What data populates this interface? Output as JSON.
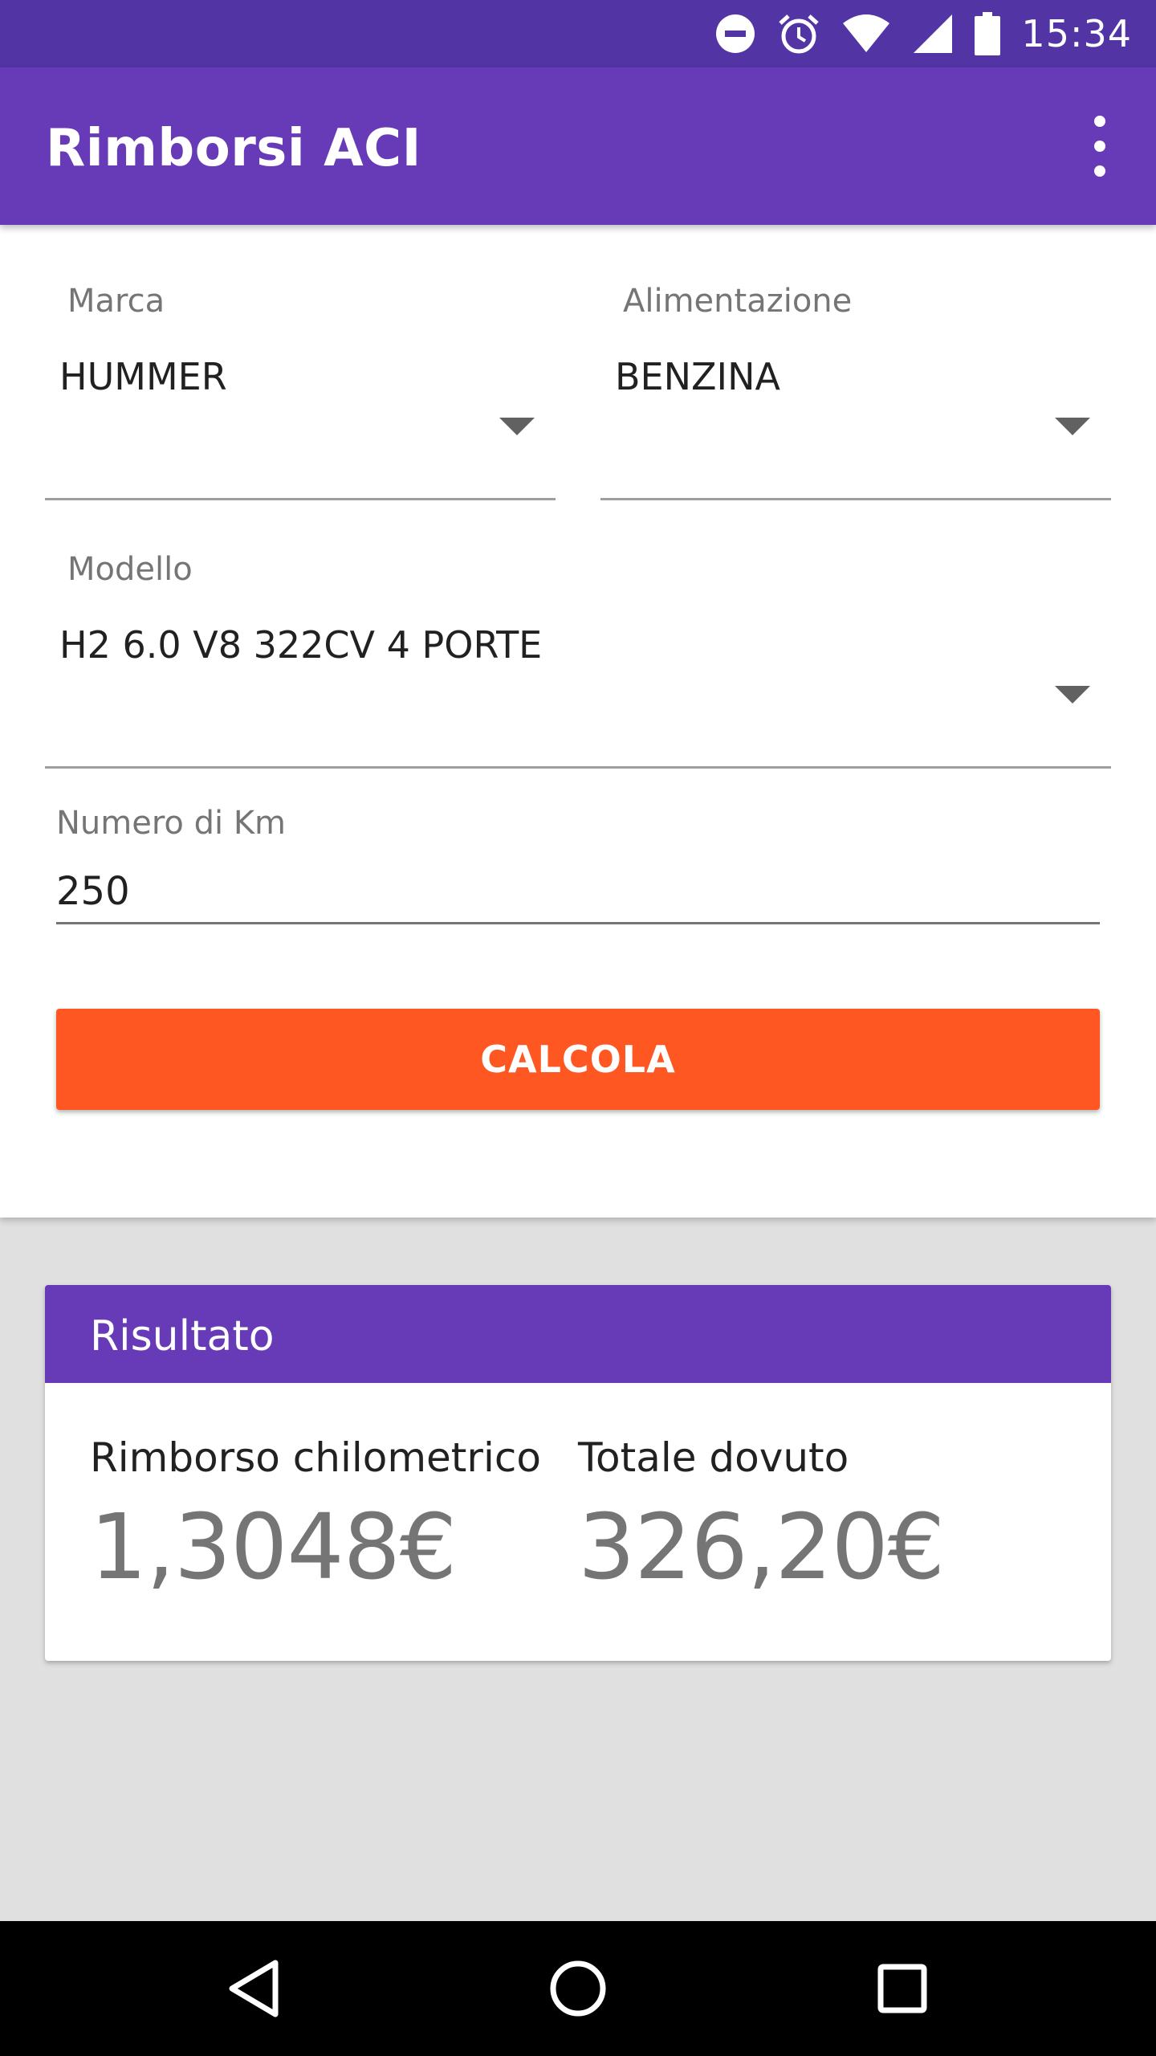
{
  "status_bar": {
    "time": "15:34",
    "icons": [
      "do-not-disturb-icon",
      "alarm-icon",
      "wifi-icon",
      "cellular-signal-icon",
      "battery-icon"
    ]
  },
  "app_bar": {
    "title": "Rimborsi ACI",
    "menu_icon": "more-vert-icon"
  },
  "form": {
    "marca": {
      "label": "Marca",
      "value": "HUMMER"
    },
    "alimentazione": {
      "label": "Alimentazione",
      "value": "BENZINA"
    },
    "modello": {
      "label": "Modello",
      "value": "H2 6.0 V8 322CV 4 PORTE"
    },
    "km": {
      "label": "Numero di Km",
      "value": "250"
    },
    "calc_button": "CALCOLA"
  },
  "result": {
    "title": "Risultato",
    "rimborso_label": "Rimborso chilometrico",
    "rimborso_value": "1,3048€",
    "totale_label": "Totale dovuto",
    "totale_value": "326,20€"
  },
  "nav_bar": {
    "icons": [
      "back-icon",
      "home-icon",
      "recents-icon"
    ]
  },
  "colors": {
    "primary": "#673ab7",
    "primary_dark": "#5234a5",
    "accent": "#ff5722",
    "background": "#e0e0e0"
  }
}
